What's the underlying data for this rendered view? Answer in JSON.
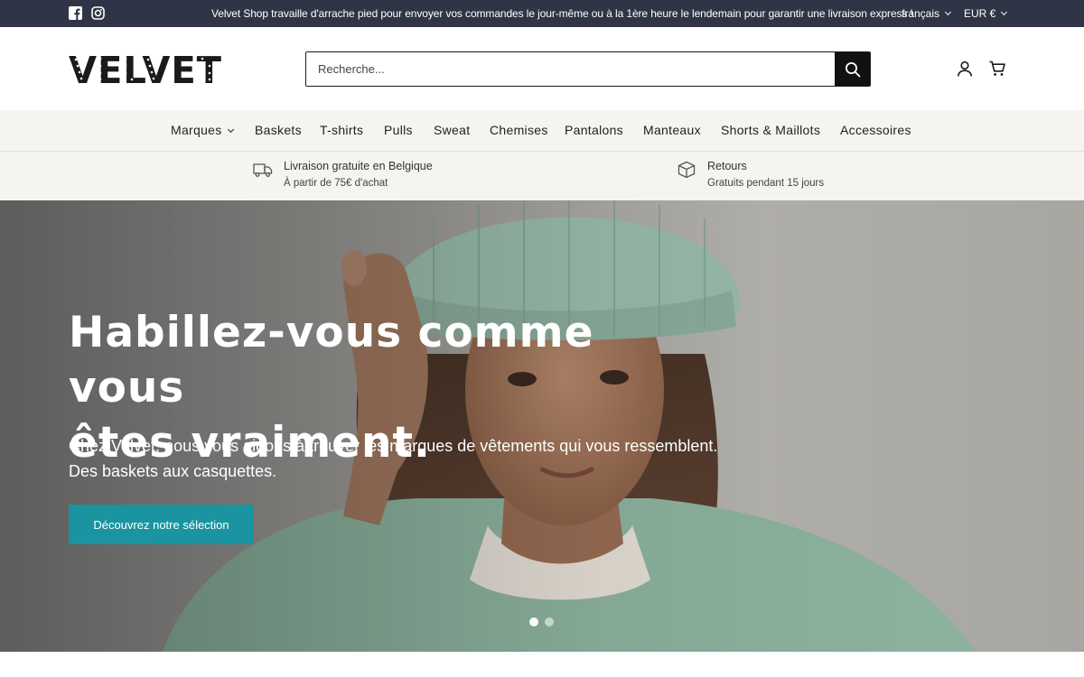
{
  "topbar": {
    "socials": [
      "facebook-icon",
      "instagram-icon"
    ],
    "message": "Velvet Shop travaille d'arrache pied pour envoyer vos commandes le jour-même ou à la 1ère heure le lendemain pour garantir une livraison express !",
    "language": "français",
    "currency": "EUR €"
  },
  "header": {
    "logo_text": "VELVET",
    "search_placeholder": "Recherche...",
    "icons": [
      "search-icon",
      "account-icon",
      "cart-icon"
    ]
  },
  "nav": {
    "items": [
      "Marques",
      "Baskets",
      "T-shirts",
      "Pulls",
      "Sweat",
      "Chemises",
      "Pantalons",
      "Manteaux",
      "Shorts & Maillots",
      "Accessoires"
    ]
  },
  "perks": [
    {
      "icon": "truck-icon",
      "title": "Livraison gratuite en Belgique",
      "subtitle": "À partir de 75€ d'achat"
    },
    {
      "icon": "box-icon",
      "title": "Retours",
      "subtitle": "Gratuits pendant 15 jours"
    }
  ],
  "hero": {
    "heading_line1": "Habillez-vous comme vous",
    "heading_line2": "êtes vraiment.",
    "sub_line1": "Chez Velvet, nous vous aidons à trouver les marques de vêtements qui vous ressemblent.",
    "sub_line2": "Des baskets aux casquettes.",
    "cta": "Découvrez notre sélection",
    "slides": 2,
    "active_slide": 1
  },
  "colors": {
    "topbar": "#2f3546",
    "nav_bg": "#f6f4f0",
    "cta": "#1a94a0"
  }
}
